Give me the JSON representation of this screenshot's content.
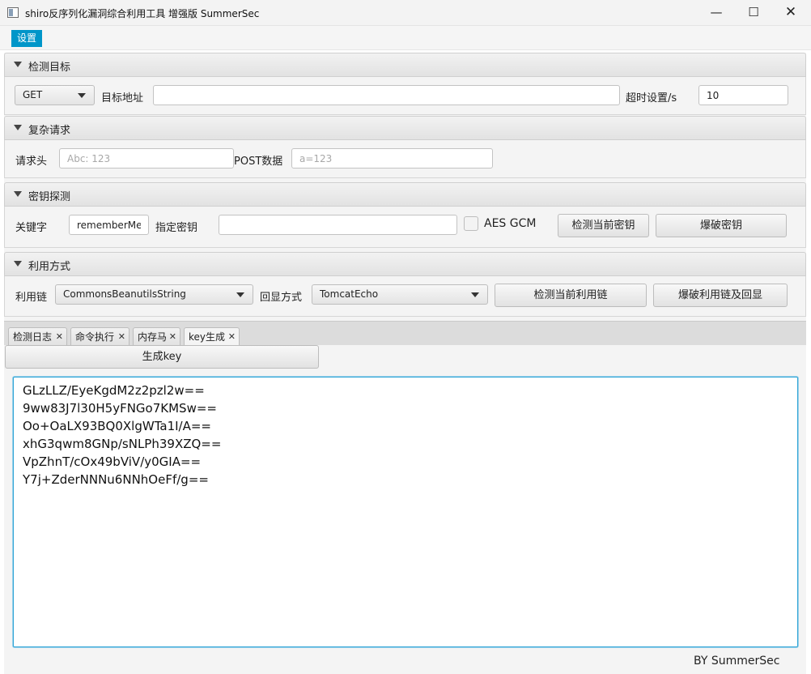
{
  "window": {
    "title": "shiro反序列化漏洞综合利用工具 增强版 SummerSec",
    "minimize": "—",
    "maximize": "☐",
    "close": "✕"
  },
  "menu": {
    "settings": "设置"
  },
  "target": {
    "title": "检测目标",
    "method": "GET",
    "url_label": "目标地址",
    "url_value": "",
    "timeout_label": "超时设置/s",
    "timeout_value": "10"
  },
  "complex": {
    "title": "复杂请求",
    "header_label": "请求头",
    "header_placeholder": "Abc: 123",
    "post_label": "POST数据",
    "post_placeholder": "a=123"
  },
  "key_detect": {
    "title": "密钥探测",
    "keyword_label": "关键字",
    "keyword_value": "rememberMe",
    "key_label": "指定密钥",
    "key_value": "",
    "aes_gcm_label": "AES GCM",
    "check_key_button": "检测当前密钥",
    "brute_key_button": "爆破密钥"
  },
  "exploit": {
    "title": "利用方式",
    "chain_label": "利用链",
    "chain_value": "CommonsBeanutilsString",
    "echo_label": "回显方式",
    "echo_value": "TomcatEcho",
    "check_chain_button": "检测当前利用链",
    "brute_chain_button": "爆破利用链及回显"
  },
  "tabs": [
    {
      "label": "检测日志",
      "close": "✕"
    },
    {
      "label": "命令执行",
      "close": "✕"
    },
    {
      "label": "内存马",
      "close": "✕"
    },
    {
      "label": "key生成",
      "close": "✕"
    }
  ],
  "keygen": {
    "generate_button": "生成key",
    "keys": [
      "GLzLLZ/EyeKgdM2z2pzl2w==",
      "9ww83J7l30H5yFNGo7KMSw==",
      "Oo+OaLX93BQ0XlgWTa1I/A==",
      "xhG3qwm8GNp/sNLPh39XZQ==",
      "VpZhnT/cOx49bViV/y0GIA==",
      "Y7j+ZderNNNu6NNhOeFf/g=="
    ]
  },
  "footer": "BY   SummerSec"
}
